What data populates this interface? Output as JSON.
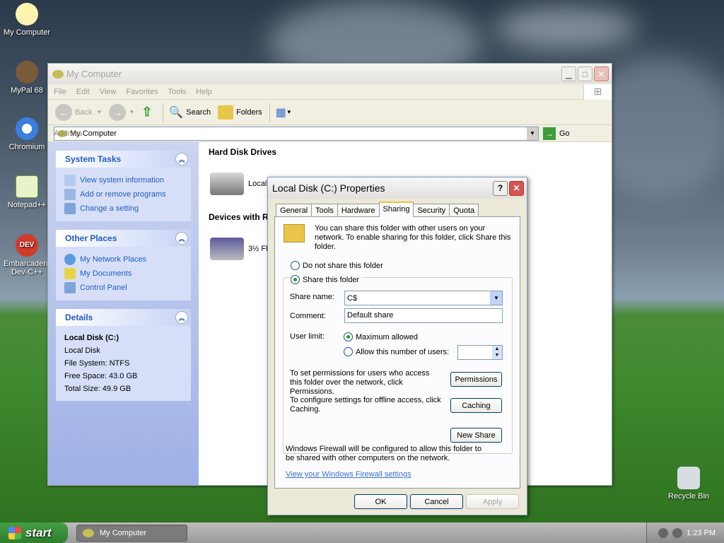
{
  "desktop": {
    "icons": [
      {
        "label": "My Computer"
      },
      {
        "label": "MyPal 68"
      },
      {
        "label": "Chromium"
      },
      {
        "label": "Notepad++"
      },
      {
        "label": "Embarcadero Dev-C++"
      },
      {
        "label": "Recycle Bin"
      }
    ]
  },
  "explorer": {
    "title": "My Computer",
    "menu": [
      "File",
      "Edit",
      "View",
      "Favorites",
      "Tools",
      "Help"
    ],
    "toolbar": {
      "back": "Back",
      "search": "Search",
      "folders": "Folders"
    },
    "address": {
      "label": "Address",
      "value": "My Computer",
      "go": "Go"
    },
    "panels": {
      "system_tasks": {
        "title": "System Tasks",
        "items": [
          "View system information",
          "Add or remove programs",
          "Change a setting"
        ]
      },
      "other_places": {
        "title": "Other Places",
        "items": [
          "My Network Places",
          "My Documents",
          "Control Panel"
        ]
      },
      "details": {
        "title": "Details",
        "name": "Local Disk (C:)",
        "type": "Local Disk",
        "fs": "File System: NTFS",
        "free": "Free Space: 43.0 GB",
        "total": "Total Size: 49.9 GB"
      }
    },
    "groups": {
      "hard_disks": "Hard Disk Drives",
      "hard_disk_item": "Local D",
      "removable": "Devices with R",
      "removable_item": "3½ Fl"
    }
  },
  "dialog": {
    "title": "Local Disk (C:) Properties",
    "help": "?",
    "tabs": [
      "General",
      "Tools",
      "Hardware",
      "Sharing",
      "Security",
      "Quota"
    ],
    "intro": "You can share this folder with other users on your network.  To enable sharing for this folder, click Share this folder.",
    "do_not_share": "Do not share this folder",
    "share_this": "Share this folder",
    "share_name_label": "Share name:",
    "share_name_value": "C$",
    "comment_label": "Comment:",
    "comment_value": "Default share",
    "user_limit_label": "User limit:",
    "max_allowed": "Maximum allowed",
    "allow_number": "Allow this number of users:",
    "permissions_text": "To set permissions for users who access this folder over the network, click Permissions.",
    "permissions_btn": "Permissions",
    "caching_text": "To configure settings for offline access, click Caching.",
    "caching_btn": "Caching",
    "new_share_btn": "New Share",
    "firewall_text": "Windows Firewall will be configured to allow this folder to be shared with other computers on the network.",
    "firewall_link": "View your Windows Firewall settings",
    "ok": "OK",
    "cancel": "Cancel",
    "apply": "Apply"
  },
  "taskbar": {
    "start": "start",
    "task": "My Computer",
    "clock": "1:23 PM"
  }
}
